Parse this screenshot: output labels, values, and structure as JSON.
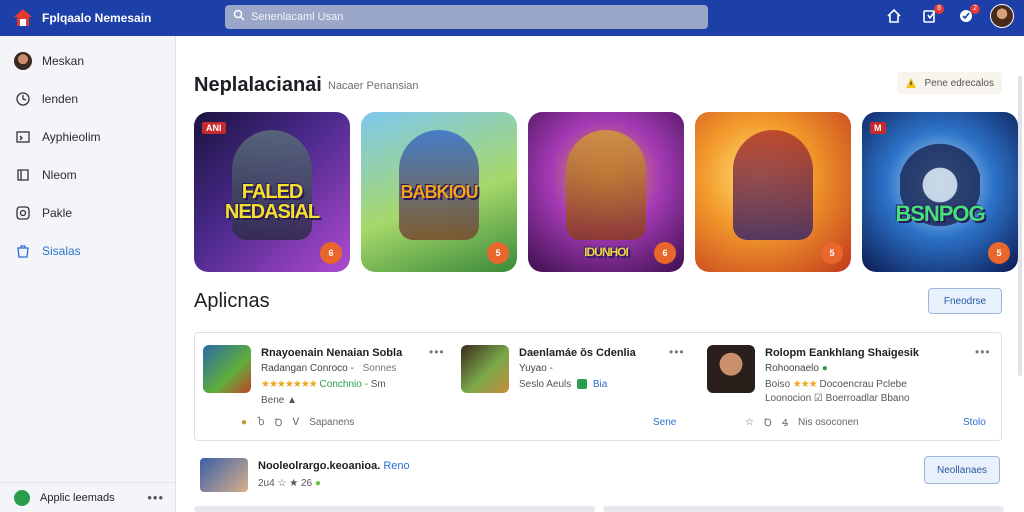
{
  "header": {
    "brand": "Fplqaalo Nemesain",
    "search_placeholder": "Senenlacaml Usan",
    "badges": {
      "downloads": "8",
      "notifications": "2"
    },
    "accent": "#1c3fa8"
  },
  "sidebar": {
    "items": [
      {
        "label": "Meskan",
        "icon": "avatar"
      },
      {
        "label": "lenden",
        "icon": "clock-icon"
      },
      {
        "label": "Ayphieolim",
        "icon": "library-icon"
      },
      {
        "label": "Nleom",
        "icon": "book-icon"
      },
      {
        "label": "Pakle",
        "icon": "play-icon"
      },
      {
        "label": "Sisalas",
        "icon": "store-icon",
        "active": true
      }
    ],
    "footer": {
      "label": "Applic leemads",
      "more": "•••"
    }
  },
  "main": {
    "featured": {
      "title": "Neplalacianai",
      "subtitle": "Nacaer Penansian",
      "filter_label": "Pene edrecalos"
    },
    "games": [
      {
        "title": "FALED\nNEDASIAL",
        "logo": "ANI",
        "badge": "6"
      },
      {
        "title": "BABKIOU",
        "logo": "",
        "badge": "5"
      },
      {
        "title": "IDUNHOI",
        "logo": "",
        "badge": "6"
      },
      {
        "title": "",
        "logo": "",
        "badge": "5"
      },
      {
        "title": "BSNPOG",
        "logo": "M",
        "badge": "5"
      }
    ],
    "apps": {
      "title": "Aplicnas",
      "button": "Fneodrse",
      "cards": [
        {
          "name": "Rnayoenain Nenaian Sobla",
          "line2_title": "Radangan Conroco -",
          "line2_extra": "Sonnes",
          "stars": "★★★★★★★",
          "rating_text": "Conchnio -",
          "rating_extra": "Sm",
          "line3": "Bene ▲",
          "actions": [
            "Ⴆ",
            "Ꝺ",
            "ᐯ",
            "Ꜯ",
            "Sapanens"
          ],
          "link": ""
        },
        {
          "name": "Daenlamáe ŏs Cdenlia",
          "line2_title": "Yuyao -",
          "line2_extra": "",
          "stars": "",
          "rating_text": "Seslo Aeuls",
          "rating_extra": "Bia",
          "line3": "",
          "actions": [],
          "link": "Sene"
        },
        {
          "name": "Rolopm Eankhlang Shaigesik",
          "line2_title": "Rohoonaelo",
          "line2_extra": "",
          "stars": "★★★",
          "rating_text": "Boiso",
          "rating_extra": "Docoencrau Pclebe",
          "line3": "Loonocion ☑ Boerroadlar  Bbano",
          "actions": [
            "☆",
            "Ꝺ",
            "Ꜯ",
            "Nis osoconen"
          ],
          "link": "Stolo"
        }
      ]
    },
    "row2": {
      "name": "Nooleolrargo.keoanioa.",
      "tag": "Reno",
      "meta": "2u4 ☆ ★ 26",
      "button": "Neollanaes"
    }
  }
}
